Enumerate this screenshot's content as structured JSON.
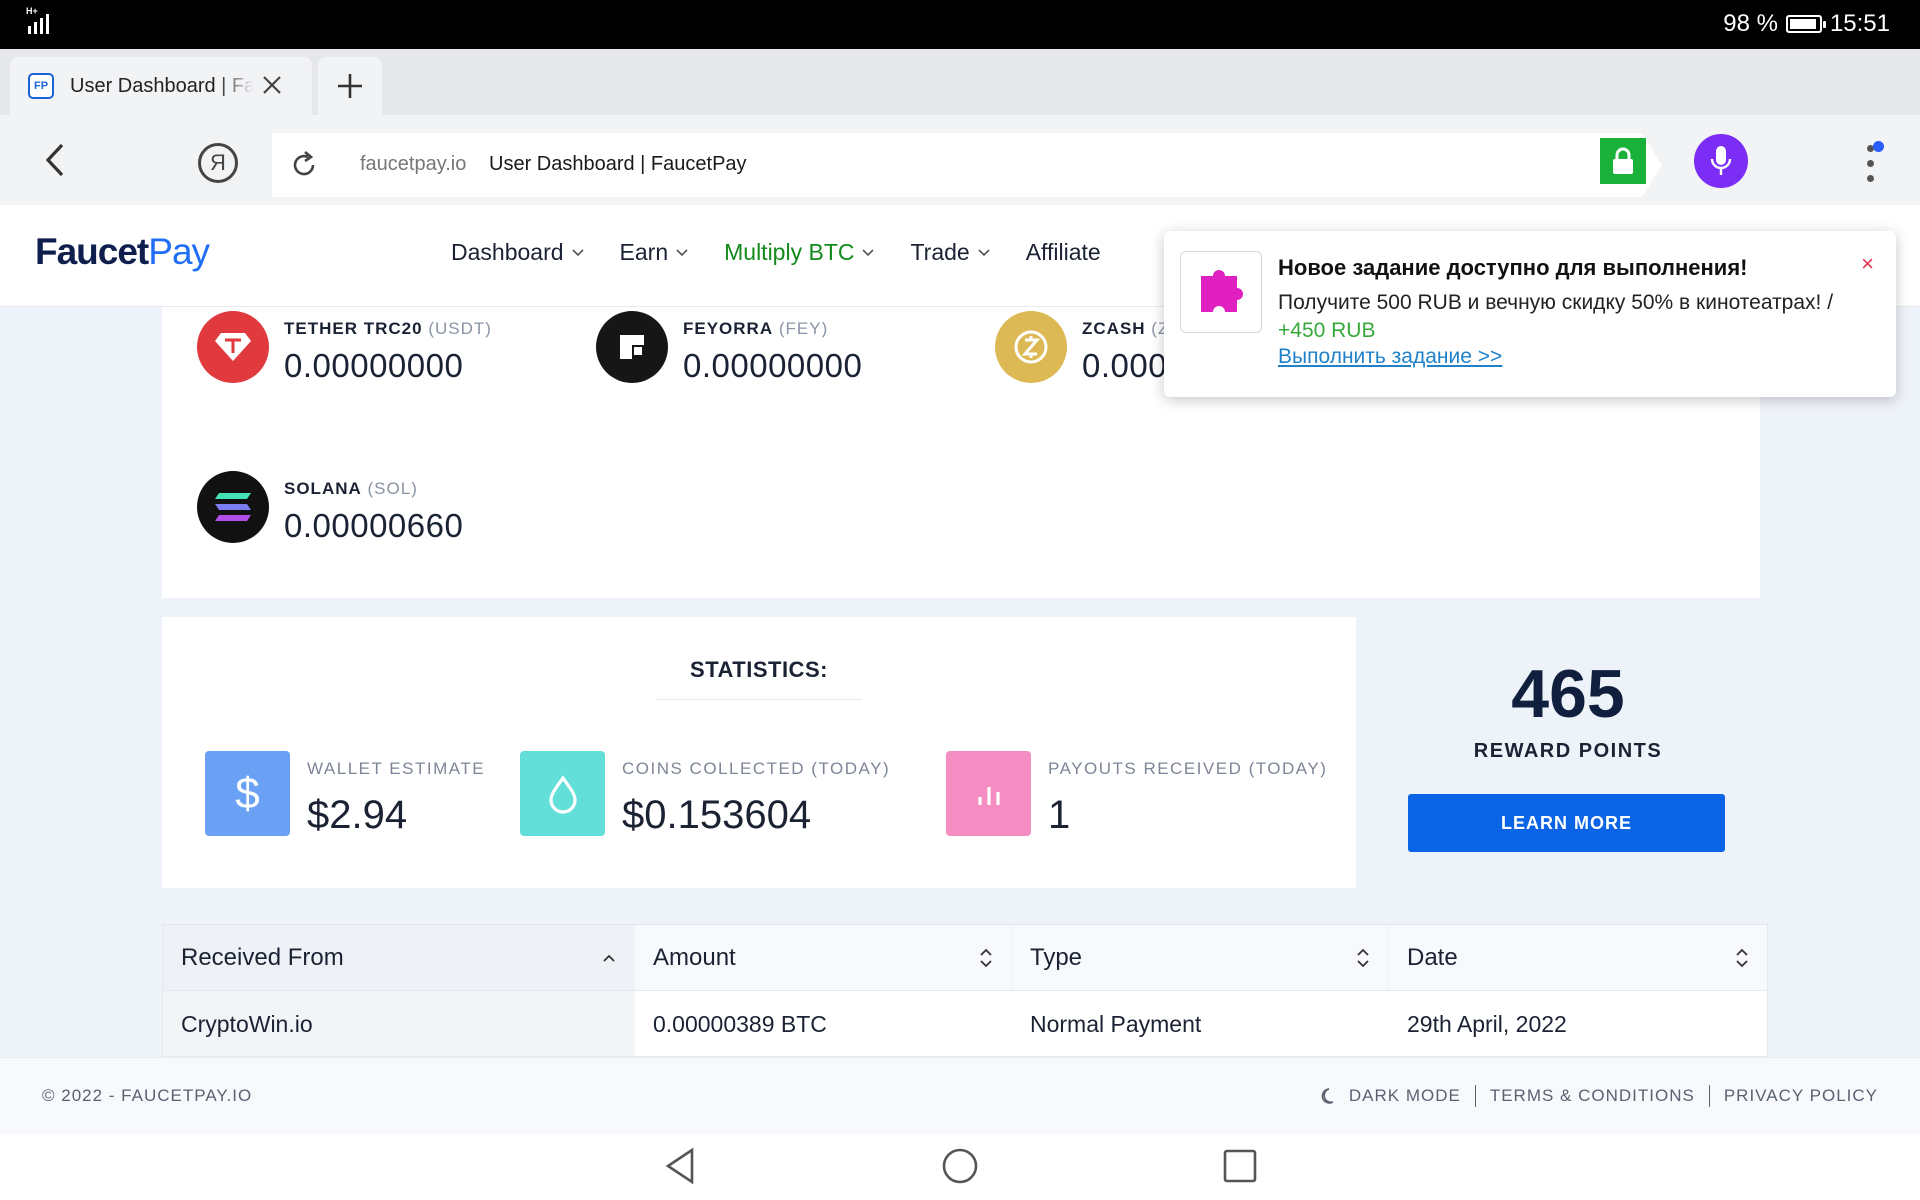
{
  "status": {
    "battery": "98 %",
    "time": "15:51",
    "network": "H+"
  },
  "browser": {
    "tab_title": "User Dashboard | FaucetPay",
    "tab_favicon": "FP",
    "domain": "faucetpay.io",
    "page_title": "User Dashboard | FaucetPay",
    "yandex": "Я"
  },
  "site": {
    "logo_a": "Faucet",
    "logo_b": "Pay",
    "nav": [
      {
        "label": "Dashboard"
      },
      {
        "label": "Earn"
      },
      {
        "label": "Multiply BTC"
      },
      {
        "label": "Trade"
      },
      {
        "label": "Affiliate"
      }
    ]
  },
  "coins": [
    {
      "name": "TETHER TRC20",
      "ticker": "(USDT)",
      "balance": "0.00000000",
      "color": "#e03a3e"
    },
    {
      "name": "FEYORRA",
      "ticker": "(FEY)",
      "balance": "0.00000000",
      "color": "#161616"
    },
    {
      "name": "ZCASH",
      "ticker": "(Z",
      "balance": "0.000",
      "color": "#ddb955"
    },
    {
      "name": "SOLANA",
      "ticker": "(SOL)",
      "balance": "0.00000660",
      "color": "#111111"
    }
  ],
  "statistics": {
    "title": "STATISTICS:",
    "items": [
      {
        "label": "WALLET ESTIMATE",
        "value": "$2.94",
        "icon": "dollar-icon",
        "color": "#6aa1f5",
        "glyph": "$"
      },
      {
        "label": "COINS COLLECTED (TODAY)",
        "value": "$0.153604",
        "icon": "drop-icon",
        "color": "#63dfd9"
      },
      {
        "label": "PAYOUTS RECEIVED (TODAY)",
        "value": "1",
        "icon": "bar-chart-icon",
        "color": "#f38dc2"
      }
    ]
  },
  "rewards": {
    "points": "465",
    "label": "REWARD POINTS",
    "button": "LEARN MORE"
  },
  "table": {
    "headers": [
      "Received From",
      "Amount",
      "Type",
      "Date"
    ],
    "rows": [
      [
        "CryptoWin.io",
        "0.00000389 BTC",
        "Normal Payment",
        "29th April, 2022"
      ]
    ]
  },
  "footer": {
    "copyright": "© 2022 - FAUCETPAY.IO",
    "links": [
      "DARK MODE",
      "TERMS & CONDITIONS",
      "PRIVACY POLICY"
    ]
  },
  "notification": {
    "title": "Новое задание доступно для выполнения!",
    "body": "Получите 500 RUB и вечную скидку 50% в кинотеатрах! /",
    "bonus": "+450 RUB",
    "link": "Выполнить задание >>",
    "close": "×"
  }
}
